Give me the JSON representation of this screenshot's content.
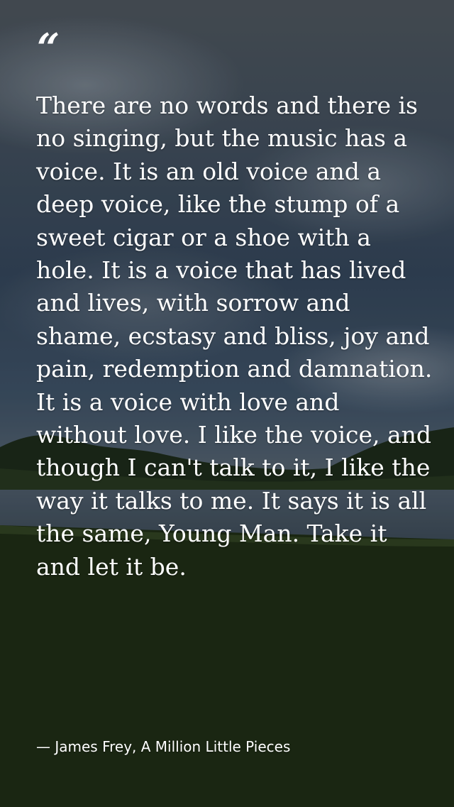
{
  "quote": {
    "mark": "“",
    "text": "There are no words and there is no singing, but the music has a voice. It is an old voice and a deep voice, like the stump of a sweet cigar or a shoe with a hole. It is a voice that has lived and lives, with sorrow and shame, ecstasy and bliss, joy and pain, redemption and damnation. It is a voice with love and without love. I like the voice, and though I can't talk to it, I like the way it talks to me. It says it is all the same, Young Man. Take it and let it be.",
    "attribution": "— James Frey, A Million Little Pieces"
  },
  "colors": {
    "text": "#ffffff",
    "sky": "#3f4c5a",
    "grass": "#1f2e16"
  }
}
